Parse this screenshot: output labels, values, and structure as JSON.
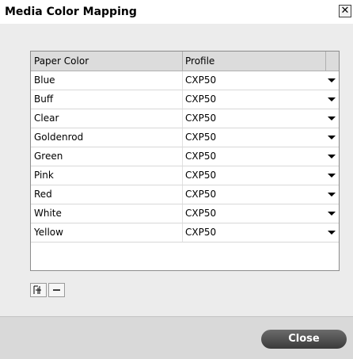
{
  "window": {
    "title": "Media Color Mapping",
    "close_icon": "close-x-icon"
  },
  "table": {
    "columns": [
      "Paper Color",
      "Profile"
    ],
    "rows": [
      {
        "paper_color": "Blue",
        "profile": "CXP50"
      },
      {
        "paper_color": "Buff",
        "profile": "CXP50"
      },
      {
        "paper_color": "Clear",
        "profile": "CXP50"
      },
      {
        "paper_color": "Goldenrod",
        "profile": "CXP50"
      },
      {
        "paper_color": "Green",
        "profile": "CXP50"
      },
      {
        "paper_color": "Pink",
        "profile": "CXP50"
      },
      {
        "paper_color": "Red",
        "profile": "CXP50"
      },
      {
        "paper_color": "White",
        "profile": "CXP50"
      },
      {
        "paper_color": "Yellow",
        "profile": "CXP50"
      }
    ]
  },
  "toolbar": {
    "add_icon": "add-row-icon",
    "remove_icon": "remove-row-icon",
    "remove_label": "−"
  },
  "footer": {
    "close_label": "Close"
  }
}
